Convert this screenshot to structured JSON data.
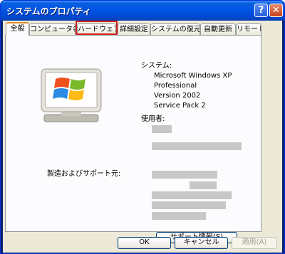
{
  "window": {
    "title": "システムのプロパティ",
    "help_glyph": "?",
    "close_glyph": "✕"
  },
  "tabs": [
    {
      "label": "全般",
      "selected": true
    },
    {
      "label": "コンピュータ名",
      "selected": false
    },
    {
      "label": "ハードウェア",
      "selected": false
    },
    {
      "label": "詳細設定",
      "selected": false
    },
    {
      "label": "システムの復元",
      "selected": false
    },
    {
      "label": "自動更新",
      "selected": false
    },
    {
      "label": "リモート",
      "selected": false
    }
  ],
  "general": {
    "system_heading": "システム:",
    "os_lines": [
      "Microsoft Windows XP",
      "Professional",
      "Version 2002",
      "Service Pack 2"
    ],
    "user_heading": "使用者:",
    "manufacturer_heading": "製造およびサポート元:",
    "support_button": "サポート情報(S)"
  },
  "buttons": {
    "ok": "OK",
    "cancel": "キャンセル",
    "apply": "適用(A)"
  },
  "colors": {
    "titlebar": "#0054e3",
    "selected_tab_accent": "#e68b2c",
    "highlight_box": "#d41c1c"
  }
}
